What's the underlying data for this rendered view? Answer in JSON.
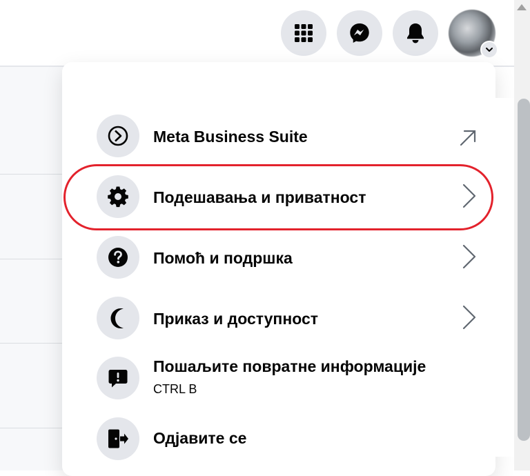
{
  "header": {
    "menu_icon": "grid-menu-icon",
    "messenger_icon": "messenger-icon",
    "notifications_icon": "bell-icon",
    "avatar_icon": "avatar",
    "avatar_badge_icon": "chevron-down-icon"
  },
  "menu": {
    "items": [
      {
        "label": "Meta Business Suite",
        "icon": "meta-business-suite-icon",
        "trailing": "external-link-icon"
      },
      {
        "label": "Подешавања и приватност",
        "icon": "gear-icon",
        "trailing": "chevron-right-icon"
      },
      {
        "label": "Помоћ и подршка",
        "icon": "help-icon",
        "trailing": "chevron-right-icon"
      },
      {
        "label": "Приказ и доступност",
        "icon": "moon-icon",
        "trailing": "chevron-right-icon"
      },
      {
        "label": "Пошаљите повратне информације",
        "sublabel": "CTRL B",
        "icon": "feedback-icon"
      },
      {
        "label": "Одјавите се",
        "icon": "logout-icon"
      }
    ]
  },
  "colors": {
    "icon_bg": "#e4e6eb",
    "highlight": "#e3222c",
    "text": "#050505"
  }
}
